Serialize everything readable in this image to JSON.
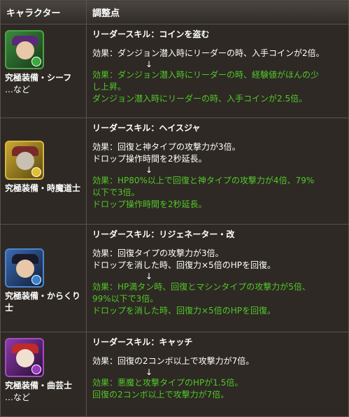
{
  "header": {
    "col_character": "キャラクター",
    "col_adjustment": "調整点"
  },
  "rows": [
    {
      "character_name": "究極装備・シーフ",
      "character_note": "…など",
      "skill": "リーダースキル：コインを盗む",
      "before": [
        "効果：ダンジョン潜入時にリーダーの時、入手コインが2倍。"
      ],
      "arrow": "↓",
      "after": [
        "効果：ダンジョン潜入時にリーダーの時、経験値がほんの少",
        "し上昇。",
        "ダンジョン潜入時にリーダーの時、入手コインが2.5倍。"
      ],
      "icon": "thief-portrait-icon"
    },
    {
      "character_name": "究極装備・時魔道士",
      "character_note": "",
      "skill": "リーダースキル：ヘイスジャ",
      "before": [
        "効果：回復と神タイプの攻撃力が3倍。",
        "ドロップ操作時間を2秒延長。"
      ],
      "arrow": "↓",
      "after": [
        "効果：HP80%以上で回復と神タイプの攻撃力が4倍、79%",
        "以下で3倍。",
        "ドロップ操作時間を2秒延長。"
      ],
      "icon": "time-mage-portrait-icon"
    },
    {
      "character_name": "究極装備・からくり士",
      "character_note": "",
      "skill": "リーダースキル：リジェネーター・改",
      "before": [
        "効果：回復タイプの攻撃力が3倍。",
        "ドロップを消した時、回復力×5倍のHPを回復。"
      ],
      "arrow": "↓",
      "after": [
        "効果：HP満タン時、回復とマシンタイプの攻撃力が5倍、",
        "99%以下で3倍。",
        "ドロップを消した時、回復力×5倍のHPを回復。"
      ],
      "icon": "machinist-portrait-icon"
    },
    {
      "character_name": "究極装備・曲芸士",
      "character_note": "…など",
      "skill": "リーダースキル：キャッチ",
      "before": [
        "効果：回復の2コンボ以上で攻撃力が7倍。"
      ],
      "arrow": "↓",
      "after": [
        "効果：悪魔と攻撃タイプのHPが1.5倍。",
        "回復の2コンボ以上で攻撃力が7倍。"
      ],
      "icon": "acrobat-portrait-icon"
    }
  ]
}
